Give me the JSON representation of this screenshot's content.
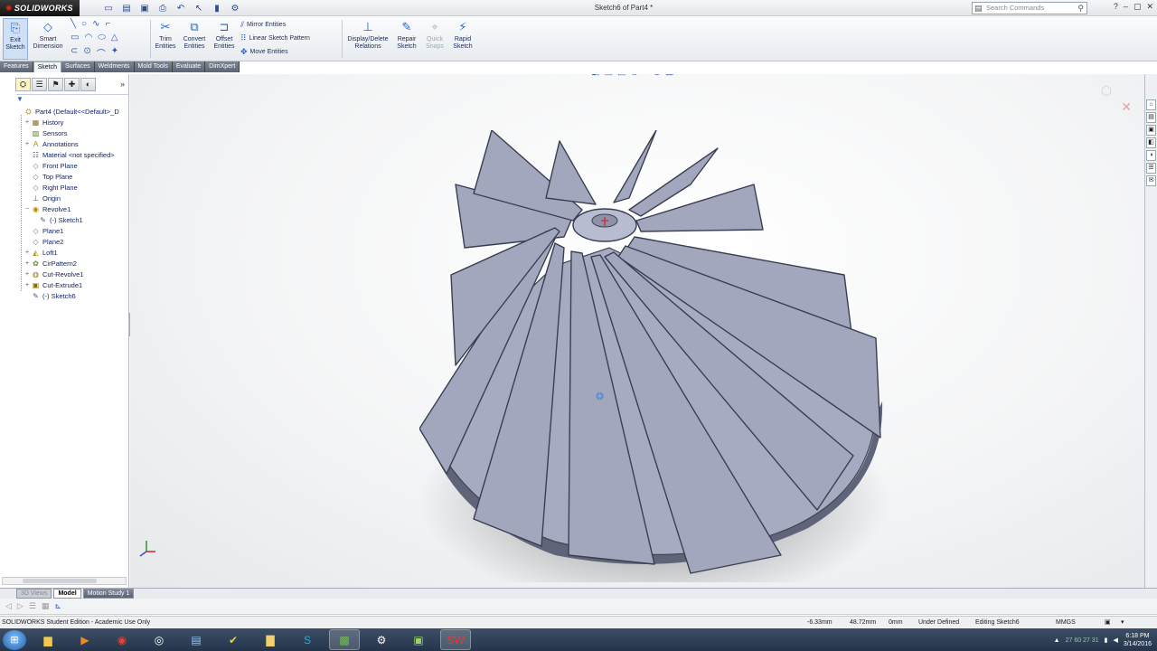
{
  "app": {
    "logo_text": "SOLIDWORKS",
    "document_title": "Sketch6 of Part4 *",
    "search_placeholder": "Search Commands"
  },
  "command_manager": {
    "exit_sketch": "Exit Sketch",
    "smart_dimension": "Smart Dimension",
    "trim_entities": "Trim Entities",
    "convert_entities": "Convert Entities",
    "offset_entities": "Offset Entities",
    "mirror_entities": "Mirror Entities",
    "linear_sketch_pattern": "Linear Sketch Pattern",
    "move_entities": "Move Entities",
    "display_delete_relations": "Display/Delete Relations",
    "repair_sketch": "Repair Sketch",
    "quick_snaps": "Quick Snaps",
    "rapid_sketch": "Rapid Sketch"
  },
  "tabs": [
    "Features",
    "Sketch",
    "Surfaces",
    "Weldments",
    "Mold Tools",
    "Evaluate",
    "DimXpert"
  ],
  "active_tab": "Sketch",
  "tree": [
    {
      "label": "Part4  (Default<<Default>_D",
      "icon": "part-icon",
      "expand": "",
      "indent": 0
    },
    {
      "label": "History",
      "icon": "history-icon",
      "expand": "+",
      "indent": 1
    },
    {
      "label": "Sensors",
      "icon": "sensor-icon",
      "expand": "",
      "indent": 1
    },
    {
      "label": "Annotations",
      "icon": "annotation-icon",
      "expand": "+",
      "indent": 1
    },
    {
      "label": "Material <not specified>",
      "icon": "material-icon",
      "expand": "",
      "indent": 1
    },
    {
      "label": "Front Plane",
      "icon": "plane-icon",
      "expand": "",
      "indent": 1
    },
    {
      "label": "Top Plane",
      "icon": "plane-icon",
      "expand": "",
      "indent": 1
    },
    {
      "label": "Right Plane",
      "icon": "plane-icon",
      "expand": "",
      "indent": 1
    },
    {
      "label": "Origin",
      "icon": "origin-icon",
      "expand": "",
      "indent": 1
    },
    {
      "label": "Revolve1",
      "icon": "revolve-icon",
      "expand": "−",
      "indent": 1
    },
    {
      "label": "(-) Sketch1",
      "icon": "sketch-icon",
      "expand": "",
      "indent": 2
    },
    {
      "label": "Plane1",
      "icon": "plane-icon",
      "expand": "",
      "indent": 1
    },
    {
      "label": "Plane2",
      "icon": "plane-icon",
      "expand": "",
      "indent": 1
    },
    {
      "label": "Loft1",
      "icon": "loft-icon",
      "expand": "+",
      "indent": 1
    },
    {
      "label": "CirPattern2",
      "icon": "pattern-icon",
      "expand": "+",
      "indent": 1
    },
    {
      "label": "Cut-Revolve1",
      "icon": "cut-revolve-icon",
      "expand": "+",
      "indent": 1
    },
    {
      "label": "Cut-Extrude1",
      "icon": "cut-extrude-icon",
      "expand": "+",
      "indent": 1
    },
    {
      "label": "(-) Sketch6",
      "icon": "sketch-icon",
      "expand": "",
      "indent": 1
    }
  ],
  "bottom_tabs": [
    "3D Views",
    "Model",
    "Motion Study 1"
  ],
  "status": {
    "edition": "SOLIDWORKS Student Edition - Academic Use Only",
    "x": "-6.33mm",
    "y": "48.72mm",
    "z": "0mm",
    "state": "Under Defined",
    "editing": "Editing Sketch6",
    "units": "MMGS"
  },
  "taskbar": {
    "tray_numbers": "27  60  27  31",
    "time": "6:18 PM",
    "date": "3/14/2016"
  },
  "colors": {
    "model_face": "#a3a7bd",
    "accent": "#2a64c4",
    "taskbar": "#2b3c54"
  }
}
